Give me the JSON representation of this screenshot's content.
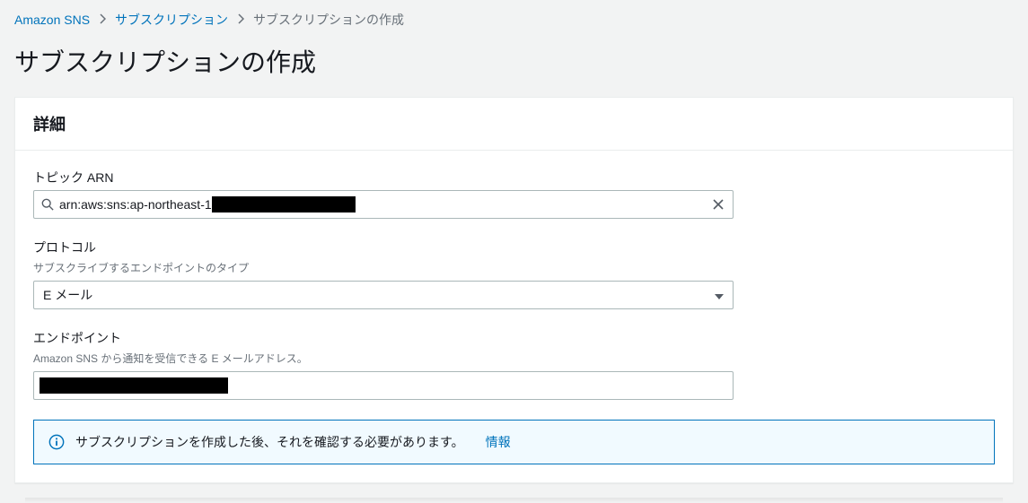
{
  "breadcrumb": {
    "root": "Amazon SNS",
    "level1": "サブスクリプション",
    "current": "サブスクリプションの作成"
  },
  "page_title": "サブスクリプションの作成",
  "panel": {
    "header": "詳細",
    "topic_arn": {
      "label": "トピック ARN",
      "value_prefix": "arn:aws:sns:ap-northeast-1",
      "value_redacted": true
    },
    "protocol": {
      "label": "プロトコル",
      "hint": "サブスクライブするエンドポイントのタイプ",
      "selected": "E メール"
    },
    "endpoint": {
      "label": "エンドポイント",
      "hint": "Amazon SNS から通知を受信できる E メールアドレス。",
      "value_redacted": true
    },
    "info": {
      "text": "サブスクリプションを作成した後、それを確認する必要があります。",
      "link": "情報"
    }
  }
}
